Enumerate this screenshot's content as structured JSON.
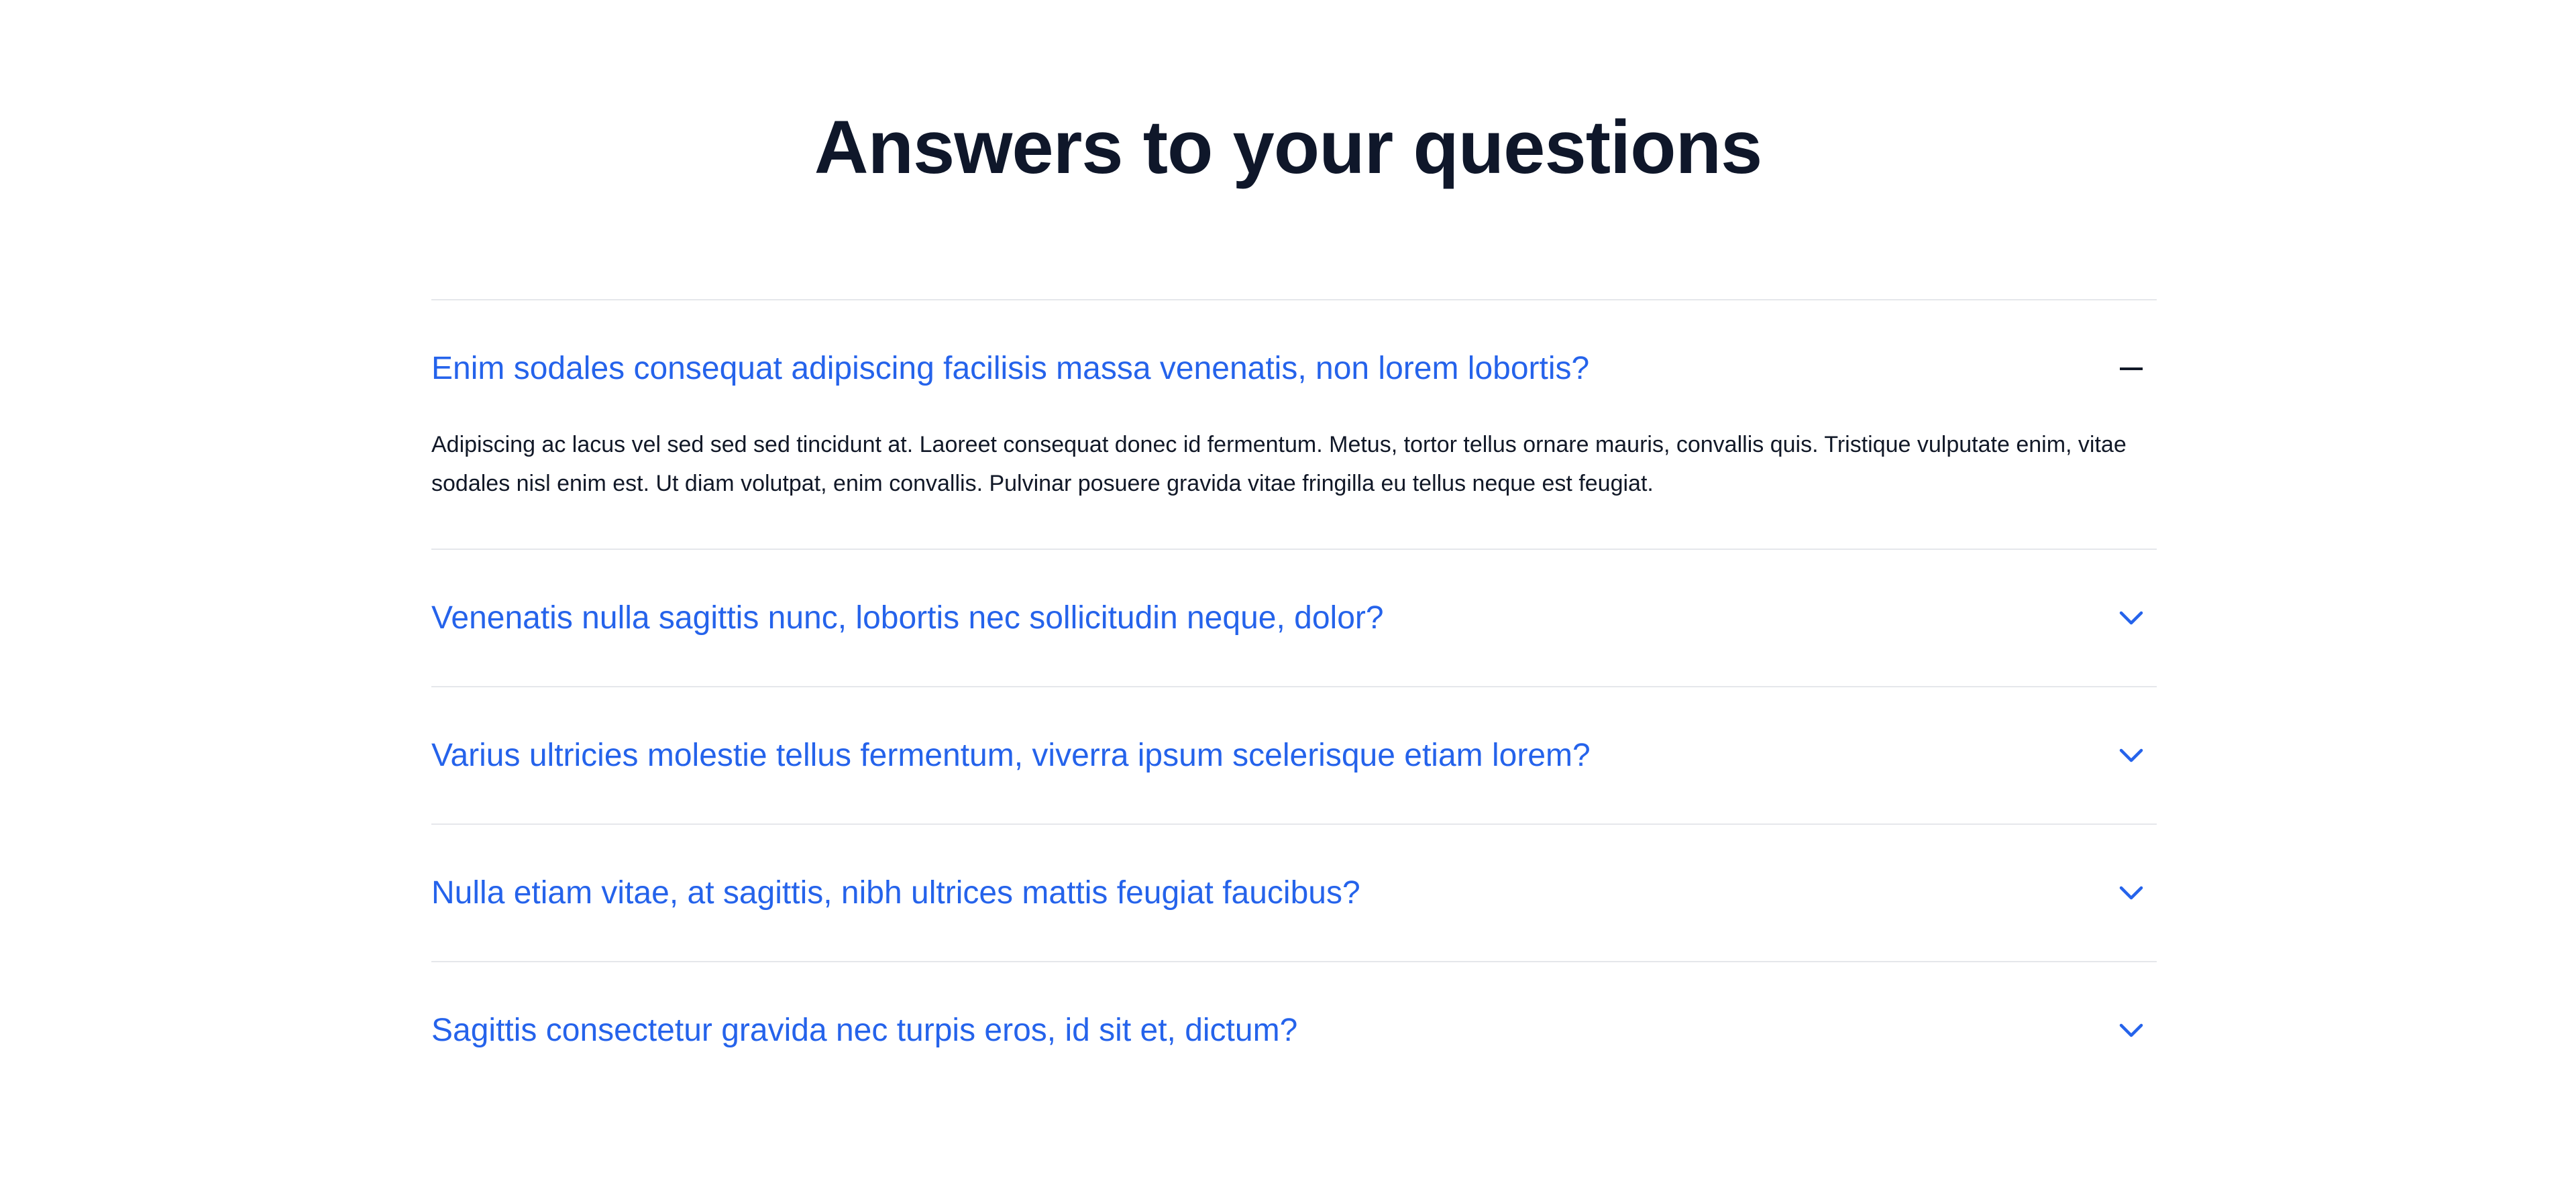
{
  "heading": "Answers to your questions",
  "colors": {
    "heading": "#0f172a",
    "question": "#2563eb",
    "divider": "#e5e7eb",
    "answer": "#111827"
  },
  "faq": [
    {
      "question": "Enim sodales consequat adipiscing facilisis massa venenatis, non lorem lobortis?",
      "answer": "Adipiscing ac lacus vel sed sed sed tincidunt at. Laoreet consequat donec id fermentum. Metus, tortor tellus ornare mauris, convallis quis. Tristique vulputate enim, vitae sodales nisl enim est. Ut diam volutpat, enim convallis. Pulvinar posuere gravida vitae fringilla eu tellus neque est feugiat.",
      "expanded": true,
      "icon": "minus-icon"
    },
    {
      "question": "Venenatis nulla sagittis nunc, lobortis nec sollicitudin neque, dolor?",
      "expanded": false,
      "icon": "chevron-down-icon"
    },
    {
      "question": "Varius ultricies molestie tellus fermentum, viverra ipsum scelerisque etiam lorem?",
      "expanded": false,
      "icon": "chevron-down-icon"
    },
    {
      "question": "Nulla etiam vitae, at sagittis, nibh ultrices mattis feugiat faucibus?",
      "expanded": false,
      "icon": "chevron-down-icon"
    },
    {
      "question": "Sagittis consectetur gravida nec turpis eros, id sit et, dictum?",
      "expanded": false,
      "icon": "chevron-down-icon"
    }
  ]
}
